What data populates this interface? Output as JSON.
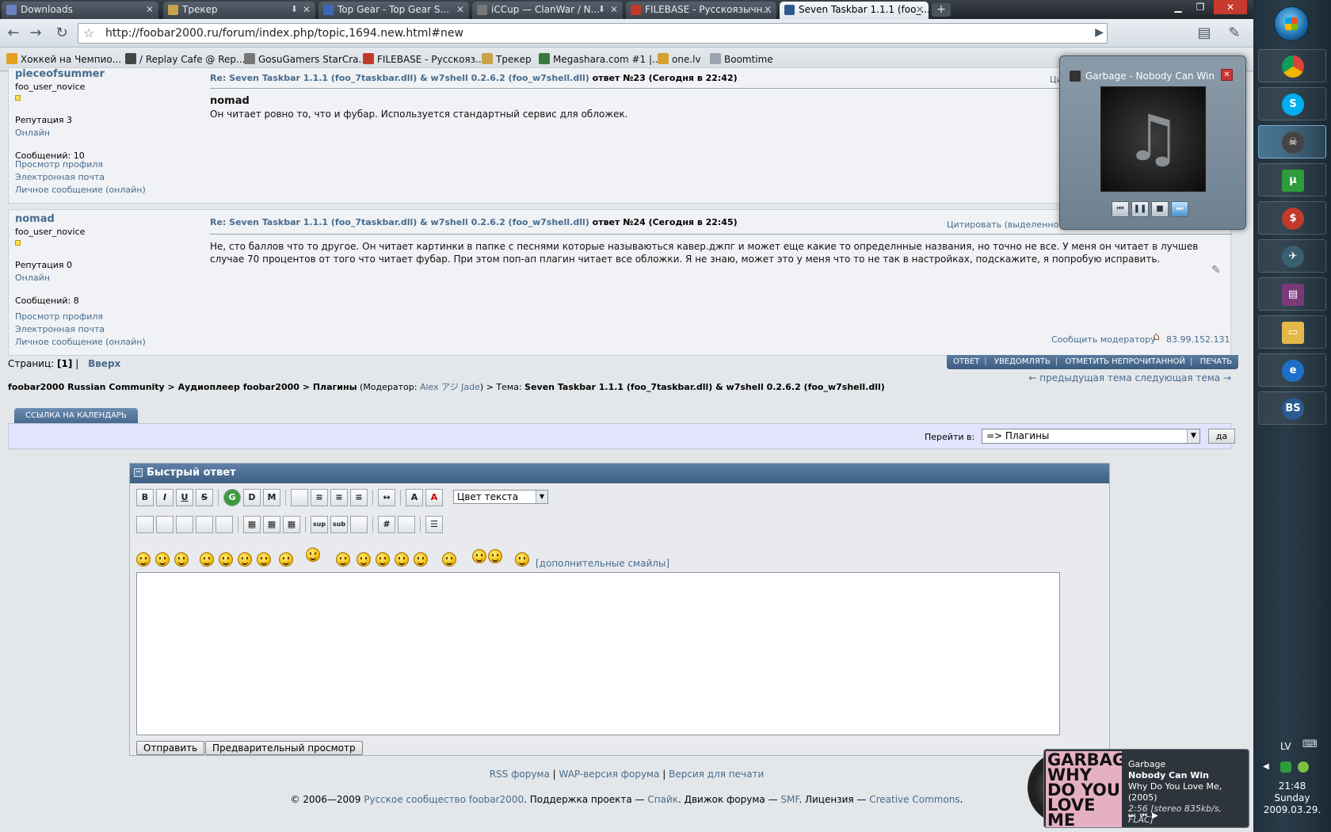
{
  "browser": {
    "tabs": [
      {
        "label": "Downloads",
        "color": "#6a84c2"
      },
      {
        "label": "Трекер",
        "color": "#c9a24a"
      },
      {
        "label": "Top Gear - Top Gear S...",
        "color": "#3a6ab5"
      },
      {
        "label": "iCCup — ClanWar / N...",
        "color": "#777777"
      },
      {
        "label": "FILEBASE - Русскоязычн...",
        "color": "#c0392b"
      },
      {
        "label": "Seven Taskbar 1.1.1 (foo_...",
        "color": "#2f5a8c"
      }
    ],
    "url": "http://foobar2000.ru/forum/index.php/topic,1694.new.html#new",
    "bookmarks": [
      {
        "label": "Хоккей на Чемпио...",
        "color": "#e2a020"
      },
      {
        "label": "/ Replay Cafe @ Rep...",
        "color": "#444444"
      },
      {
        "label": "GosuGamers StarCra...",
        "color": "#777777"
      },
      {
        "label": "FILEBASE - Русскояз...",
        "color": "#c0392b"
      },
      {
        "label": "Трекер",
        "color": "#c9a24a"
      },
      {
        "label": "Megashara.com #1 |...",
        "color": "#3a7a3a"
      },
      {
        "label": "one.lv",
        "color": "#d4a030"
      },
      {
        "label": "Boomtime",
        "color": "#9aa4b0"
      }
    ]
  },
  "posts": [
    {
      "author": "pieceofsummer",
      "rank": "foo_user_novice",
      "reputation": "Репутация 3",
      "status": "Онлайн",
      "messages": "Сообщений: 10",
      "links": [
        "Просмотр профиля",
        "Электронная почта",
        "Личное сообщение (онлайн)"
      ],
      "title_link": "Re: Seven Taskbar 1.1.1 (foo_7taskbar.dll) & w7shell 0.2.6.2 (foo_w7shell.dll)",
      "title_meta": " ответ №23 (Сегодня в 22:42)",
      "body_bold": "nomad",
      "body": "Он читает ровно то, что и фубар. Используется стандартный сервис для обложек.",
      "quote_partial": "Цит"
    },
    {
      "author": "nomad",
      "rank": "foo_user_novice",
      "reputation": "Репутация 0",
      "status": "Онлайн",
      "messages": "Сообщений: 8",
      "links": [
        "Просмотр профиля",
        "Электронная почта",
        "Личное сообщение (онлайн)"
      ],
      "title_link": "Re: Seven Taskbar 1.1.1 (foo_7taskbar.dll) & w7shell 0.2.6.2 (foo_w7shell.dll)",
      "title_meta": " ответ №24 (Сегодня в 22:45)",
      "body": "Не, сто баллов что то другое. Он читает картинки в папке с песнями которые называються кавер.джпг и может еще какие то определнные названия, но точно не все. У меня он читает в лучшев случае 70 процентов от того что читает фубар. При этом поп-ап плагин читает все обложки. Я не знаю, может это у меня что то не так в настройках, подскажите, я попробую исправить.",
      "quote": "Цитировать (выделенное)",
      "report": "Сообщить модератору",
      "ip": "83.99.152.131"
    }
  ],
  "pagenav": {
    "label": "Страниц:",
    "current": "[1]",
    "sep": "|",
    "up": "Вверх"
  },
  "actions": [
    "ОТВЕТ",
    "УВЕДОМЛЯТЬ",
    "ОТМЕТИТЬ НЕПРОЧИТАННОЙ",
    "ПЕЧАТЬ"
  ],
  "topicnav": "← предыдущая тема следующая тема →",
  "breadcrumb": {
    "parts": "foobar2000 Russian Community > Аудиоплеер foobar2000 > Плагины",
    "mod_prefix": " (Модератор: ",
    "mod_name": "Alex アジ Jade",
    "mod_suffix": ") > Тема: ",
    "topic": "Seven Taskbar 1.1.1 (foo_7taskbar.dll) & w7shell 0.2.6.2 (foo_w7shell.dll)"
  },
  "calendar_tab": "ССЫЛКА НА КАЛЕНДАРЬ",
  "jump": {
    "label": "Перейти в:",
    "value": "=> Плагины",
    "button": "да"
  },
  "quick_reply": {
    "title": "Быстрый ответ",
    "color_select": "Цвет текста",
    "more_smileys": "[дополнительные смайлы]",
    "send": "Отправить",
    "preview": "Предварительный просмотр",
    "toolbar_row1": [
      "B",
      "I",
      "U",
      "S",
      "G",
      "D",
      "M",
      "",
      "≡",
      "≡",
      "≡",
      "↔",
      "A",
      "A"
    ],
    "toolbar_row2": [
      "",
      "",
      "",
      "",
      "",
      "",
      "",
      "",
      "sup",
      "sub",
      "",
      "#",
      "",
      ""
    ]
  },
  "footer": {
    "links": [
      "RSS форума",
      "WAP-версия форума",
      "Версия для печати"
    ],
    "copy_prefix": "© 2006—2009 ",
    "copy_org": "Русское сообщество foobar2000",
    "copy_mid1": ". Поддержка проекта — ",
    "copy_support": "Спайк",
    "copy_mid2": ". Движок форума — ",
    "copy_engine": "SMF",
    "copy_mid3": ". Лицензия — ",
    "copy_license": "Creative Commons",
    "copy_end": "."
  },
  "popup": {
    "title": "Garbage - Nobody Can Win"
  },
  "nowplaying": {
    "artist": "Garbage",
    "song": "Nobody Can Win",
    "album": "Why Do You Love Me, (2005)",
    "info": "2:56 [stereo 835kb/s, FLAC]",
    "cover_text": "GARBAGE WHY DO YOU LOVE ME"
  },
  "taskbar": {
    "lang": "LV",
    "time": "21:48",
    "day": "Sunday",
    "date": "2009.03.29."
  }
}
